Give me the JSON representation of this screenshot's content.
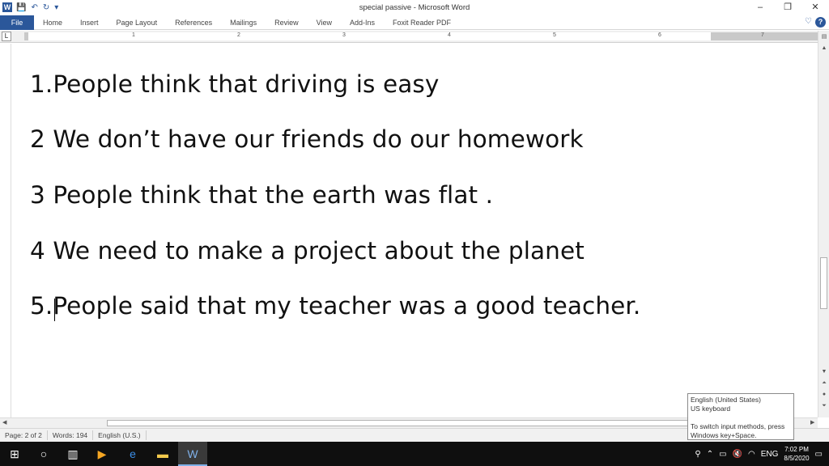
{
  "app": {
    "title": "special passive  -  Microsoft Word",
    "app_icon": "W"
  },
  "window_controls": {
    "minimize": "–",
    "maximize": "❐",
    "close": "✕"
  },
  "ribbon": {
    "file_tab": "File",
    "tabs": [
      "Home",
      "Insert",
      "Page Layout",
      "References",
      "Mailings",
      "Review",
      "View",
      "Add-Ins",
      "Foxit Reader PDF"
    ]
  },
  "ruler": {
    "tab_selector": "L",
    "numbers": [
      "1",
      "2",
      "3",
      "4",
      "5",
      "6",
      "7"
    ]
  },
  "document": {
    "lines": [
      "1.People think that driving is easy",
      "2 We don’t have our friends do our homework",
      "3 People think that the earth was flat .",
      "4 We need to make a project about the planet",
      "5.People said that my teacher was a good teacher."
    ]
  },
  "status_bar": {
    "page": "Page: 2 of 2",
    "words": "Words: 194",
    "language": "English (U.S.)"
  },
  "ime_tooltip": {
    "line1": "English (United States)",
    "line2": "US keyboard",
    "line3": "To switch input methods, press",
    "line4": "Windows key+Space."
  },
  "taskbar": {
    "lang": "ENG",
    "time": "7:02 PM",
    "date": "8/5/2020"
  }
}
